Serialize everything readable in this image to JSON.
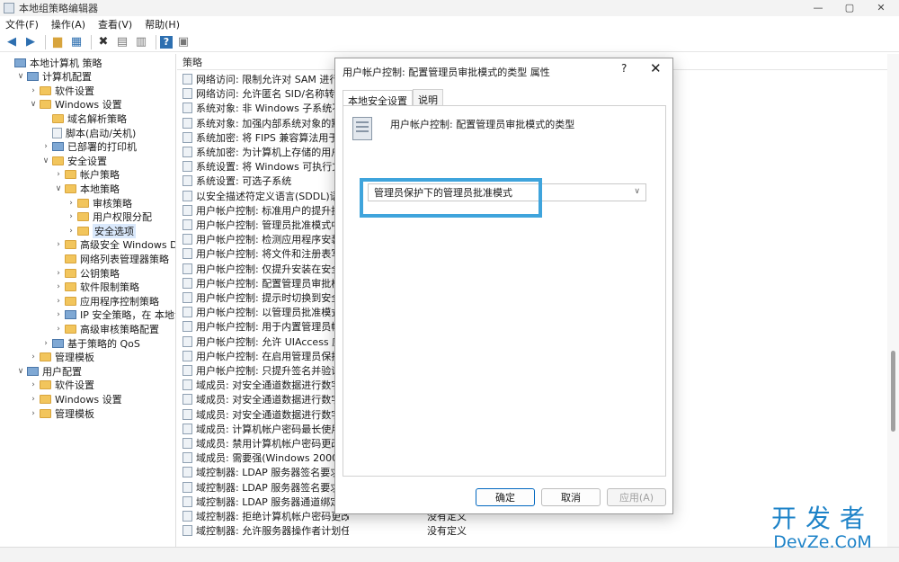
{
  "window": {
    "title": "本地组策略编辑器",
    "controls": {
      "minimize": "—",
      "maximize": "▢",
      "close": "✕"
    }
  },
  "menu": [
    "文件(F)",
    "操作(A)",
    "查看(V)",
    "帮助(H)"
  ],
  "toolbar": [
    "back-icon",
    "forward-icon",
    "up-folder-icon",
    "show-hide-tree-icon",
    "delete-icon",
    "properties-icon",
    "export-icon",
    "help-icon",
    "view-icon"
  ],
  "tree": [
    {
      "label": "本地计算机 策略",
      "exp": "",
      "icon": "pc",
      "indent": 0
    },
    {
      "label": "计算机配置",
      "exp": "∨",
      "icon": "pc",
      "indent": 1
    },
    {
      "label": "软件设置",
      "exp": "›",
      "icon": "folder",
      "indent": 2
    },
    {
      "label": "Windows 设置",
      "exp": "∨",
      "icon": "folder",
      "indent": 2
    },
    {
      "label": "域名解析策略",
      "exp": "",
      "icon": "folder",
      "indent": 3
    },
    {
      "label": "脚本(启动/关机)",
      "exp": "",
      "icon": "doc",
      "indent": 3
    },
    {
      "label": "已部署的打印机",
      "exp": "›",
      "icon": "pc",
      "indent": 3
    },
    {
      "label": "安全设置",
      "exp": "∨",
      "icon": "folder",
      "indent": 3
    },
    {
      "label": "帐户策略",
      "exp": "›",
      "icon": "folder",
      "indent": 4
    },
    {
      "label": "本地策略",
      "exp": "∨",
      "icon": "folder",
      "indent": 4
    },
    {
      "label": "审核策略",
      "exp": "›",
      "icon": "folder",
      "indent": 5
    },
    {
      "label": "用户权限分配",
      "exp": "›",
      "icon": "folder",
      "indent": 5
    },
    {
      "label": "安全选项",
      "exp": "›",
      "icon": "folder",
      "indent": 5,
      "selected": true
    },
    {
      "label": "高级安全 Windows Defen",
      "exp": "›",
      "icon": "folder",
      "indent": 4
    },
    {
      "label": "网络列表管理器策略",
      "exp": "",
      "icon": "folder",
      "indent": 4
    },
    {
      "label": "公钥策略",
      "exp": "›",
      "icon": "folder",
      "indent": 4
    },
    {
      "label": "软件限制策略",
      "exp": "›",
      "icon": "folder",
      "indent": 4
    },
    {
      "label": "应用程序控制策略",
      "exp": "›",
      "icon": "folder",
      "indent": 4
    },
    {
      "label": "IP 安全策略，在 本地计算机",
      "exp": "›",
      "icon": "pc",
      "indent": 4
    },
    {
      "label": "高级审核策略配置",
      "exp": "›",
      "icon": "folder",
      "indent": 4
    },
    {
      "label": "基于策略的 QoS",
      "exp": "›",
      "icon": "pc",
      "indent": 3
    },
    {
      "label": "管理模板",
      "exp": "›",
      "icon": "folder",
      "indent": 2
    },
    {
      "label": "用户配置",
      "exp": "∨",
      "icon": "pc",
      "indent": 1
    },
    {
      "label": "软件设置",
      "exp": "›",
      "icon": "folder",
      "indent": 2
    },
    {
      "label": "Windows 设置",
      "exp": "›",
      "icon": "folder",
      "indent": 2
    },
    {
      "label": "管理模板",
      "exp": "›",
      "icon": "folder",
      "indent": 2
    }
  ],
  "list": {
    "header": "策略",
    "rows": [
      {
        "policy": "网络访问: 限制允许对 SAM 进行远程",
        "setting": ""
      },
      {
        "policy": "网络访问: 允许匿名 SID/名称转换",
        "setting": ""
      },
      {
        "policy": "系统对象: 非 Windows 子系统不要求",
        "setting": ""
      },
      {
        "policy": "系统对象: 加强内部系统对象的默认权",
        "setting": ""
      },
      {
        "policy": "系统加密: 将 FIPS 兼容算法用于加密、",
        "setting": ""
      },
      {
        "policy": "系统加密: 为计算机上存储的用户密钥",
        "setting": ""
      },
      {
        "policy": "系统设置: 将 Windows 可执行文件中",
        "setting": ""
      },
      {
        "policy": "系统设置: 可选子系统",
        "setting": ""
      },
      {
        "policy": "以安全描述符定义语言(SDDL)语法表示",
        "setting": ""
      },
      {
        "policy": "用户帐户控制: 标准用户的提升提示行",
        "setting": ""
      },
      {
        "policy": "用户帐户控制: 管理员批准模式中管理",
        "setting": ""
      },
      {
        "policy": "用户帐户控制: 检测应用程序安装并提",
        "setting": ""
      },
      {
        "policy": "用户帐户控制: 将文件和注册表写入错",
        "setting": ""
      },
      {
        "policy": "用户帐户控制: 仅提升安装在安全位置",
        "setting": ""
      },
      {
        "policy": "用户帐户控制:   配置管理员审批模式的",
        "setting": ""
      },
      {
        "policy": "用户帐户控制: 提示时切换到安全",
        "setting": ""
      },
      {
        "policy": "用户帐户控制: 以管理员批准模式运行",
        "setting": ""
      },
      {
        "policy": "用户帐户控制: 用于内置管理员帐户的",
        "setting": ""
      },
      {
        "policy": "用户帐户控制: 允许 UIAccess 应用程",
        "setting": ""
      },
      {
        "policy": "用户帐户控制: 在启用管理员保护的情",
        "setting": ""
      },
      {
        "policy": "用户帐户控制: 只提升签名并验证的可",
        "setting": ""
      },
      {
        "policy": "域成员: 对安全通道数据进行数字加密",
        "setting": ""
      },
      {
        "policy": "域成员: 对安全通道数据进行数字加密",
        "setting": ""
      },
      {
        "policy": "域成员: 对安全通道数据进行数字签名",
        "setting": ""
      },
      {
        "policy": "域成员: 计算机帐户密码最长使用期限",
        "setting": ""
      },
      {
        "policy": "域成员: 禁用计算机帐户密码更改",
        "setting": ""
      },
      {
        "policy": "域成员: 需要强(Windows 2000 或更高",
        "setting": ""
      },
      {
        "policy": "域控制器: LDAP 服务器签名要求",
        "setting": ""
      },
      {
        "policy": "域控制器: LDAP 服务器签名要求强制",
        "setting": ""
      },
      {
        "policy": "域控制器: LDAP 服务器通道绑定令牌要",
        "setting": ""
      },
      {
        "policy": "域控制器: 拒绝计算机帐户密码更改",
        "setting": "没有定义"
      },
      {
        "policy": "域控制器: 允许服务器操作者计划任务",
        "setting": "没有定义"
      }
    ]
  },
  "dialog": {
    "title": "用户帐户控制: 配置管理员审批模式的类型 属性",
    "help": "?",
    "close": "✕",
    "tabs": [
      "本地安全设置",
      "说明"
    ],
    "policy_name": "用户帐户控制:  配置管理员审批模式的类型",
    "select_value": "管理员保护下的管理员批准模式",
    "buttons": {
      "ok": "确定",
      "cancel": "取消",
      "apply": "应用(A)"
    },
    "highlight_color": "#3fa4dc"
  },
  "watermark": {
    "cn": "开发者",
    "en": "DevZe.CoM"
  }
}
